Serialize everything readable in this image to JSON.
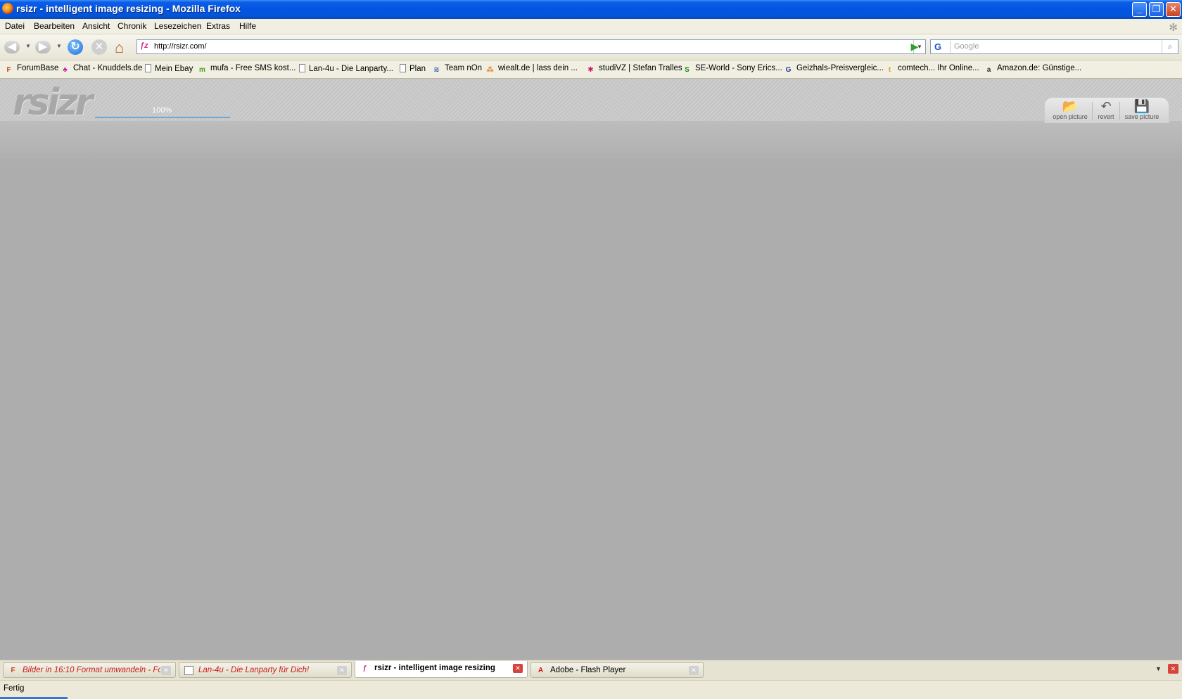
{
  "window": {
    "title": "rsizr - intelligent image resizing - Mozilla Firefox",
    "buttons": {
      "minimize": "_",
      "maximize": "❐",
      "close": "✕"
    }
  },
  "menu": [
    "Datei",
    "Bearbeiten",
    "Ansicht",
    "Chronik",
    "Lesezeichen",
    "Extras",
    "Hilfe"
  ],
  "nav": {
    "url": "http://rsizr.com/",
    "favicon_text": "ƒz",
    "search_engine": "G",
    "search_placeholder": "Google"
  },
  "bookmarks": [
    {
      "label": "ForumBase",
      "icon": "forumbase-icon",
      "glyph": "F",
      "color": "#c8401a"
    },
    {
      "label": "Chat - Knuddels.de",
      "icon": "knuddels-icon",
      "glyph": "♣",
      "color": "#c41a9a"
    },
    {
      "label": "Mein Ebay",
      "icon": "page-icon",
      "glyph": "",
      "color": "#888888"
    },
    {
      "label": "mufa - Free SMS kost...",
      "icon": "mufa-icon",
      "glyph": "m",
      "color": "#4f9a1c"
    },
    {
      "label": "Lan-4u - Die Lanparty...",
      "icon": "page-icon",
      "glyph": "",
      "color": "#888888"
    },
    {
      "label": "Plan",
      "icon": "page-icon",
      "glyph": "",
      "color": "#888888"
    },
    {
      "label": "Team nOn",
      "icon": "team-non-icon",
      "glyph": "≋",
      "color": "#2a5aa8"
    },
    {
      "label": "wiealt.de | lass dein ...",
      "icon": "wiealt-icon",
      "glyph": "⁂",
      "color": "#e07a1a"
    },
    {
      "label": "studiVZ | Stefan Tralles",
      "icon": "studivz-icon",
      "glyph": "✱",
      "color": "#c41a6a"
    },
    {
      "label": "SE-World - Sony Erics...",
      "icon": "se-world-icon",
      "glyph": "S",
      "color": "#1a8a1a"
    },
    {
      "label": "Geizhals-Preisvergleic...",
      "icon": "geizhals-icon",
      "glyph": "G",
      "color": "#1a3aa8"
    },
    {
      "label": "comtech... Ihr Online...",
      "icon": "comtech-icon",
      "glyph": "t",
      "color": "#e0a01a"
    },
    {
      "label": "Amazon.de: Günstige...",
      "icon": "amazon-icon",
      "glyph": "a",
      "color": "#333333"
    }
  ],
  "app": {
    "logo_text": "rsizr",
    "zoom_label": "100%",
    "zoom_fraction": 1.0,
    "tools": [
      {
        "label": "open picture",
        "icon": "open-folder-icon",
        "glyph": "📂"
      },
      {
        "label": "revert",
        "icon": "revert-icon",
        "glyph": "↶"
      },
      {
        "label": "save picture",
        "icon": "save-disk-icon",
        "glyph": "💾"
      }
    ]
  },
  "tabs": [
    {
      "label": "Bilder in 16:10 Format umwandeln - Fo...",
      "icon": "forumbase-icon",
      "glyph": "F",
      "color": "#c8401a",
      "active": false,
      "text_color": "#cc1a1a",
      "italic": true
    },
    {
      "label": "Lan-4u - Die Lanparty für Dich!",
      "icon": "page-icon",
      "glyph": "",
      "color": "#888888",
      "active": false,
      "text_color": "#cc1a1a",
      "italic": true
    },
    {
      "label": "rsizr - intelligent image resizing",
      "icon": "rsizr-icon",
      "glyph": "ƒ",
      "color": "#d62a8a",
      "active": true,
      "text_color": "#000000",
      "italic": false
    },
    {
      "label": "Adobe - Flash Player",
      "icon": "adobe-icon",
      "glyph": "A",
      "color": "#cc1a1a",
      "active": false,
      "text_color": "#000000",
      "italic": false
    }
  ],
  "status": {
    "text": "Fertig"
  }
}
